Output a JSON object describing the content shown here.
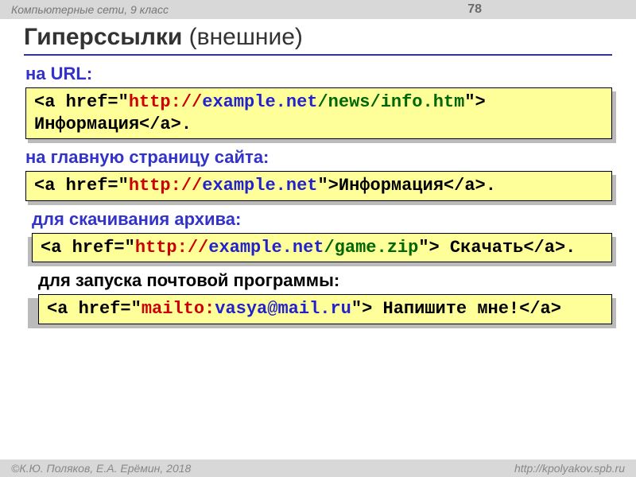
{
  "header": {
    "course": "Компьютерные сети, 9 класс",
    "page": "78"
  },
  "title": {
    "bold": "Гиперссылки",
    "rest": " (внешние)"
  },
  "sections": [
    {
      "label": "на URL:",
      "code": {
        "t1": "<a href=\"",
        "scheme": "http://",
        "host": "example.net",
        "path": "/news/info.htm",
        "t2": "\"> Информация</a>."
      }
    },
    {
      "label": "на главную страницу сайта:",
      "code": {
        "t1": "<a href=\"",
        "scheme": "http://",
        "host": "example.net",
        "path": "",
        "t2": "\">Информация</a>."
      }
    },
    {
      "label": "для скачивания архива:",
      "code": {
        "t1": "<a href=\"",
        "scheme": "http://",
        "host": "example.net",
        "path": "/game.zip",
        "t2": "\"> Скачать</a>."
      }
    },
    {
      "label": "для запуска почтовой программы:",
      "code": {
        "t1": "<a href=\"",
        "scheme": "mailto:",
        "host": "vasya@mail.ru",
        "path": "",
        "t2": "\"> Напишите мне!</a>"
      }
    }
  ],
  "footer": {
    "left": "©К.Ю. Поляков, Е.А. Ерёмин, 2018",
    "right": "http://kpolyakov.spb.ru"
  }
}
